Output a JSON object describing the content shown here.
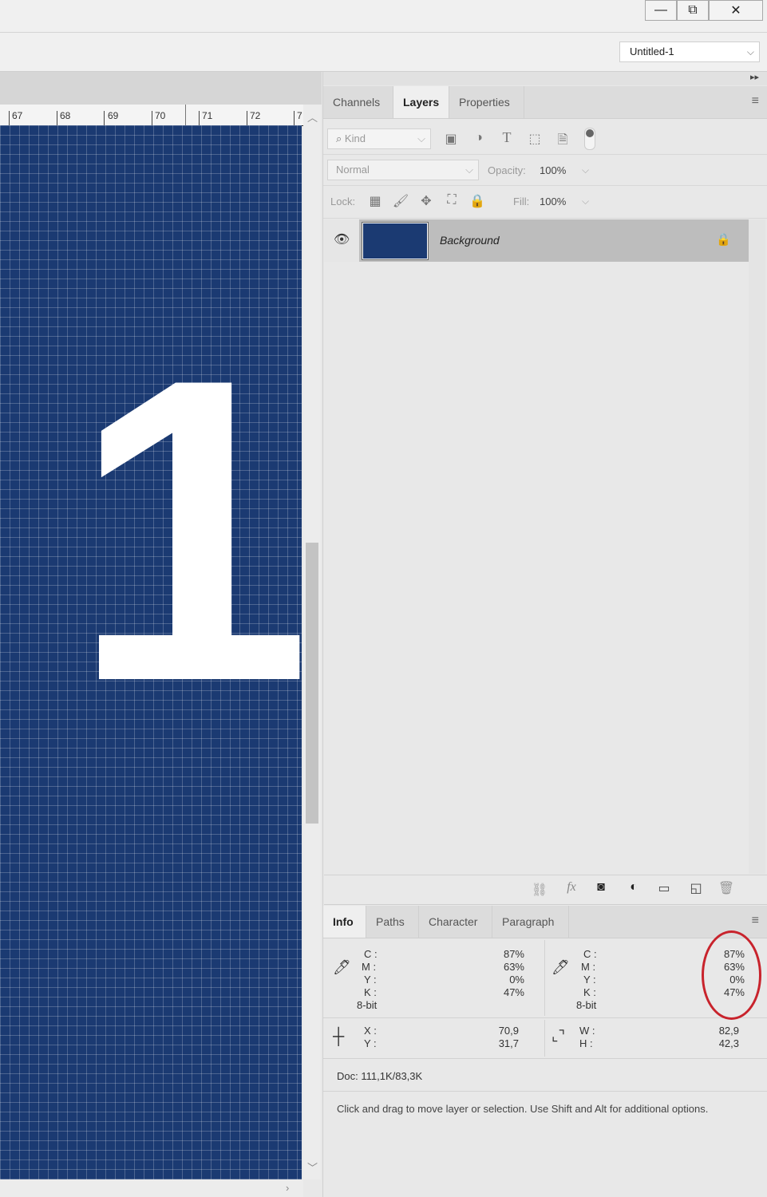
{
  "window": {
    "minimize": "—",
    "restore": "⧉",
    "close": "✕"
  },
  "options_bar": {
    "document_select": "Untitled-1"
  },
  "ruler": {
    "labels": [
      "67",
      "68",
      "69",
      "70",
      "71",
      "72",
      "7"
    ]
  },
  "canvas": {
    "text": "1",
    "color": "#1b3a72"
  },
  "layers_panel": {
    "tabs": [
      "Channels",
      "Layers",
      "Properties"
    ],
    "active_tab": "Layers",
    "filter": {
      "placeholder": "Kind"
    },
    "blend_mode": "Normal",
    "opacity_label": "Opacity:",
    "opacity_value": "100%",
    "lock_label": "Lock:",
    "fill_label": "Fill:",
    "fill_value": "100%",
    "layers": [
      {
        "name": "Background",
        "visible": true,
        "locked": true
      }
    ],
    "footer_icons": [
      "link-icon",
      "fx-icon",
      "mask-icon",
      "adjustment-icon",
      "folder-icon",
      "new-layer-icon",
      "trash-icon"
    ]
  },
  "info_panel": {
    "tabs": [
      "Info",
      "Paths",
      "Character",
      "Paragraph"
    ],
    "active_tab": "Info",
    "sample1": {
      "labels": [
        "C :",
        "M :",
        "Y :",
        "K :"
      ],
      "values": [
        "87%",
        "63%",
        "0%",
        "47%"
      ],
      "bitdepth": "8-bit"
    },
    "sample2": {
      "labels": [
        "C :",
        "M :",
        "Y :",
        "K :"
      ],
      "values": [
        "87%",
        "63%",
        "0%",
        "47%"
      ],
      "bitdepth": "8-bit"
    },
    "position": {
      "x_label": "X :",
      "y_label": "Y :",
      "x": "70,9",
      "y": "31,7"
    },
    "size": {
      "w_label": "W :",
      "h_label": "H :",
      "w": "82,9",
      "h": "42,3"
    },
    "doc": "Doc: 111,1K/83,3K",
    "hint": "Click and drag to move layer or selection.  Use Shift and Alt for additional options."
  },
  "colors": {
    "highlight_circle": "#c8232c",
    "canvas_blue": "#1b3a72"
  }
}
